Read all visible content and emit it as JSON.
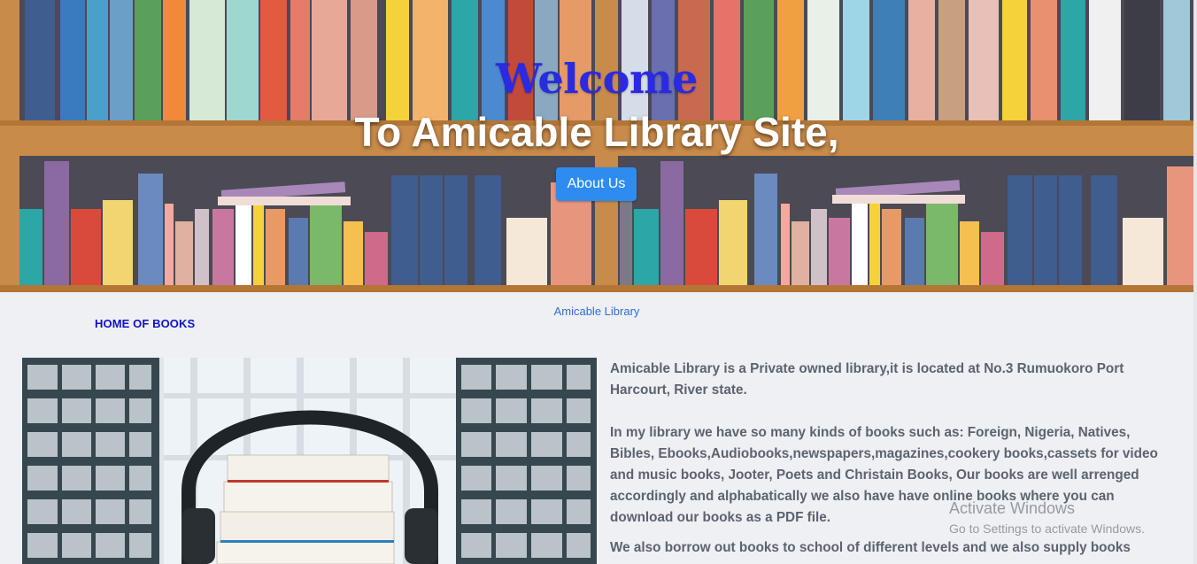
{
  "hero": {
    "welcome": "Welcome",
    "subtitle": "To Amicable Library Site,",
    "about_button": "About Us"
  },
  "nav": {
    "brand_link": "Amicable Library",
    "home_label": "HOME OF BOOKS"
  },
  "content": {
    "paragraph_1": "Amicable Library is a Private owned library,it is located at No.3 Rumuokoro Port Harcourt, River state.",
    "paragraph_2": "In my library we have so many kinds of books such as: Foreign, Nigeria, Natives, Bibles, Ebooks,Audiobooks,newspapers,magazines,cookery books,cassets for video and music books, Jooter, Poets and Christain Books, Our books are well arrenged accordingly and alphabatically we also have have online books where you can download our books as a PDF file.",
    "paragraph_3": "We also borrow out books to school of different levels and we also supply books"
  },
  "watermark": {
    "line1": "Activate Windows",
    "line2": "Go to Settings to activate Windows."
  },
  "colors": {
    "welcome": "#2a2ae0",
    "button": "#2e8cf0",
    "home_label": "#1010c8",
    "body_text": "#5c6370",
    "page_bg": "#eef0f3"
  },
  "icons": {
    "hero_image": "bookshelf-illustration",
    "photo": "headphones-on-books-photo"
  }
}
